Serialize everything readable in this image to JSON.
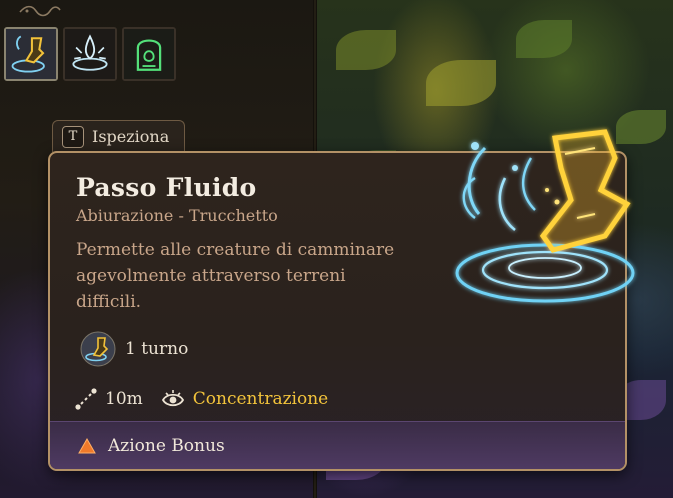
{
  "hud": {
    "spell_icons": [
      {
        "icon": "fluid-step-icon",
        "selected": true
      },
      {
        "icon": "water-burst-icon",
        "selected": false
      },
      {
        "icon": "green-rune-icon",
        "selected": false
      }
    ]
  },
  "inspect": {
    "key": "T",
    "label": "Ispeziona"
  },
  "tooltip": {
    "title": "Passo Fluido",
    "subtitle": "Abiurazione - Trucchetto",
    "description": "Permette alle creature di camminare agevolmente attraverso terreni difficili.",
    "duration": "1 turno",
    "range": "10m",
    "concentration": "Concentrazione",
    "action_type": "Azione Bonus",
    "colors": {
      "border": "#b39166",
      "concentration": "#f3c43b",
      "footer": "#4e3a62",
      "action_icon": "#f07a2a"
    }
  }
}
